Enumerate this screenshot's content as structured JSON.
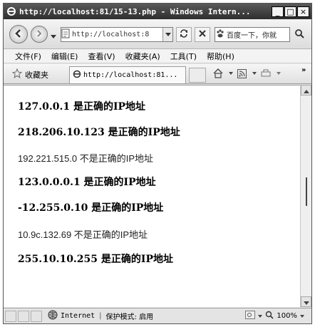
{
  "window": {
    "title": "http://localhost:81/15-13.php - Windows Intern...",
    "minimize_glyph": "_",
    "maximize_glyph": "□",
    "close_glyph": "×"
  },
  "address": {
    "url": "http://localhost:8",
    "search_placeholder": "百度一下，你就"
  },
  "menu": {
    "items": [
      "文件(F)",
      "编辑(E)",
      "查看(V)",
      "收藏夹(A)",
      "工具(T)",
      "帮助(H)"
    ]
  },
  "favorites": {
    "label": "收藏夹",
    "tab_title": "http://localhost:81..."
  },
  "content": {
    "lines": [
      {
        "text": "127.0.0.1 是正确的IP地址",
        "valid": true
      },
      {
        "text": "218.206.10.123 是正确的IP地址",
        "valid": true
      },
      {
        "text": "192.221.515.0 不是正确的IP地址",
        "valid": false
      },
      {
        "text": "123.0.0.0.1 是正确的IP地址",
        "valid": true
      },
      {
        "text": "-12.255.0.10 是正确的IP地址",
        "valid": true
      },
      {
        "text": "10.9c.132.69 不是正确的IP地址",
        "valid": false
      },
      {
        "text": "255.10.10.255 是正确的IP地址",
        "valid": true
      }
    ]
  },
  "status": {
    "zone": "Internet",
    "protected_mode": "保护模式: 启用",
    "zoom": "100%"
  },
  "icons": [
    "ie-logo-icon",
    "back-arrow-icon",
    "forward-arrow-icon",
    "refresh-icon",
    "stop-icon",
    "search-icon",
    "star-icon",
    "home-icon",
    "rss-icon",
    "print-icon",
    "globe-icon"
  ]
}
